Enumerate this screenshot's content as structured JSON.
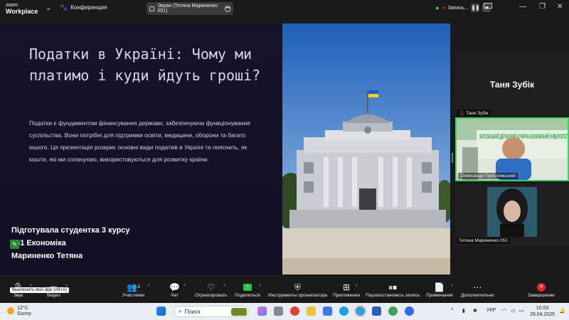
{
  "titlebar": {
    "brand_line1": "zoom",
    "brand_line2": "Workplace",
    "meeting_label": "Конференция",
    "screen_share_label": "Экран (Тетяна Мариненко 051)",
    "recording_label": "Запись..."
  },
  "slide": {
    "title": "Податки в Україні: Чому ми платимо і куди йдуть гроші?",
    "body": "Податки є фундаментом фінансування держави, забезпечуючи функціонування суспільства. Вони потрібні для підтримки освіти, медицини, оборони та багато іншого. Ця презентація розкриє основні види податків в Україні та пояснить, як кошти, які ми сплачуємо, використовуються для розвитку країни.",
    "author_line1": "Підготувала студентка 3 курсу",
    "author_line2": "051 Економіка",
    "author_line3": "Мариненко Тетяна"
  },
  "participants": [
    {
      "display_name": "Таня Зубік",
      "label": "Таня Зубік"
    },
    {
      "label": "Олександр Пристемський",
      "banner_text": "ХЕРСОНСЬКИЙ ДЕРЖАВНИЙ АГРАРНО-ЕКОНОМІЧНИЙ УНІВЕРСИТЕТ"
    },
    {
      "label": "Тетяна Мариненко 051"
    }
  ],
  "toolbar": {
    "audio": "Звук",
    "video": "Видео",
    "participants": "Участники",
    "participants_count": "3",
    "chat": "Чат",
    "react": "Отреагировать",
    "share": "Поделиться",
    "host_tools": "Инструменты организатора",
    "apps": "Приложения",
    "pause_record": "Пауза/остановить запись",
    "notes": "Примечания",
    "more": "Дополнительно",
    "end": "Завершение",
    "tooltip": "Выключить мой звук (Alt+A)"
  },
  "taskbar": {
    "temp": "12°C",
    "weather": "Sunny",
    "search_placeholder": "Поиск",
    "lang": "УКР",
    "time": "10:03",
    "date": "29.04.2025"
  },
  "colors": {
    "slide_bg": "#15132a",
    "active_speaker": "#3fd05a",
    "end_button": "#e02828",
    "share_button": "#2fbf4a"
  }
}
